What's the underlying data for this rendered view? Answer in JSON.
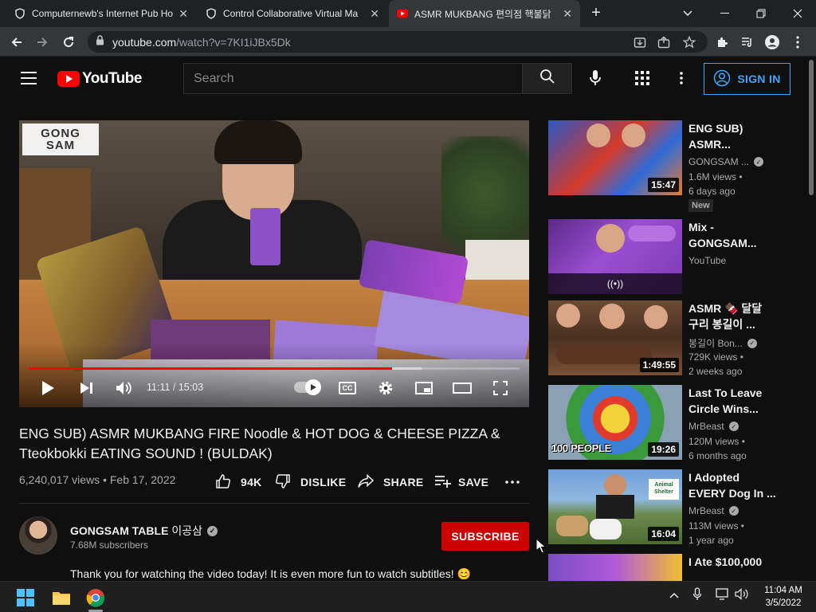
{
  "browser": {
    "tabs": [
      {
        "title": "Computernewb's Internet Pub Ho",
        "active": false,
        "icon": "shield-icon"
      },
      {
        "title": "Control Collaborative Virtual Ma",
        "active": false,
        "icon": "shield-icon"
      },
      {
        "title": "ASMR MUKBANG 편의점 핵불닭",
        "active": true,
        "icon": "youtube-icon"
      }
    ],
    "url_host": "youtube.com",
    "url_path": "/watch?v=7KI1iJBx5Dk"
  },
  "youtube": {
    "logo": "YouTube",
    "search_placeholder": "Search",
    "sign_in": "SIGN IN"
  },
  "player": {
    "watermark_line1": "GONG",
    "watermark_line2": "SAM",
    "current_time": "11:11",
    "duration": "15:03",
    "time_separator": " / ",
    "progress_fraction": 0.74,
    "buffered_fraction": 0.8
  },
  "video": {
    "title": "ENG SUB) ASMR MUKBANG FIRE Noodle & HOT DOG & CHEESE PIZZA & Tteokbokki EATING SOUND ! (BULDAK)",
    "views": "6,240,017 views",
    "date": "Feb 17, 2022",
    "meta_separator": " • ",
    "likes": "94K",
    "dislike_label": "DISLIKE",
    "share_label": "SHARE",
    "save_label": "SAVE"
  },
  "channel": {
    "name": "GONGSAM TABLE",
    "name_ko": "이공삼",
    "subscribers": "7.68M subscribers",
    "subscribe_label": "SUBSCRIBE",
    "description": "Thank you for watching the video today! It is even more fun to watch subtitles! 😊"
  },
  "related": [
    {
      "title1": "ENG SUB)",
      "title2": "ASMR...",
      "channel": "GONGSAM ...",
      "verified": true,
      "views": "1.6M views •",
      "age": "6 days ago",
      "duration": "15:47",
      "badge": "New"
    },
    {
      "title1": "Mix -",
      "title2": "GONGSAM...",
      "channel": "YouTube",
      "verified": false,
      "views": "",
      "age": "",
      "duration": "",
      "badge": ""
    },
    {
      "title1": "ASMR 🍫 달달",
      "title2": "구리 봉길이 ...",
      "channel": "봉길이 Bon...",
      "verified": true,
      "views": "729K views •",
      "age": "2 weeks ago",
      "duration": "1:49:55",
      "badge": ""
    },
    {
      "title1": "Last To Leave",
      "title2": "Circle Wins...",
      "channel": "MrBeast",
      "verified": true,
      "views": "120M views •",
      "age": "6 months ago",
      "duration": "19:26",
      "badge": "",
      "thumb_text": "100 PEOPLE"
    },
    {
      "title1": "I Adopted",
      "title2": "EVERY Dog In ...",
      "channel": "MrBeast",
      "verified": true,
      "views": "113M views •",
      "age": "1 year ago",
      "duration": "16:04",
      "badge": "",
      "thumb_sign": "Animal Shelter"
    },
    {
      "title1": "I Ate $100,000",
      "title2": "",
      "channel": "",
      "verified": false,
      "views": "",
      "age": "",
      "duration": "",
      "badge": ""
    }
  ],
  "mix_icon": "((•))",
  "taskbar": {
    "time": "11:04 AM",
    "date": "3/5/2022"
  },
  "colors": {
    "youtube_red": "#ff0000",
    "subscribe_red": "#cc0000",
    "link_blue": "#3ea6ff",
    "bg": "#0f0f0f"
  }
}
